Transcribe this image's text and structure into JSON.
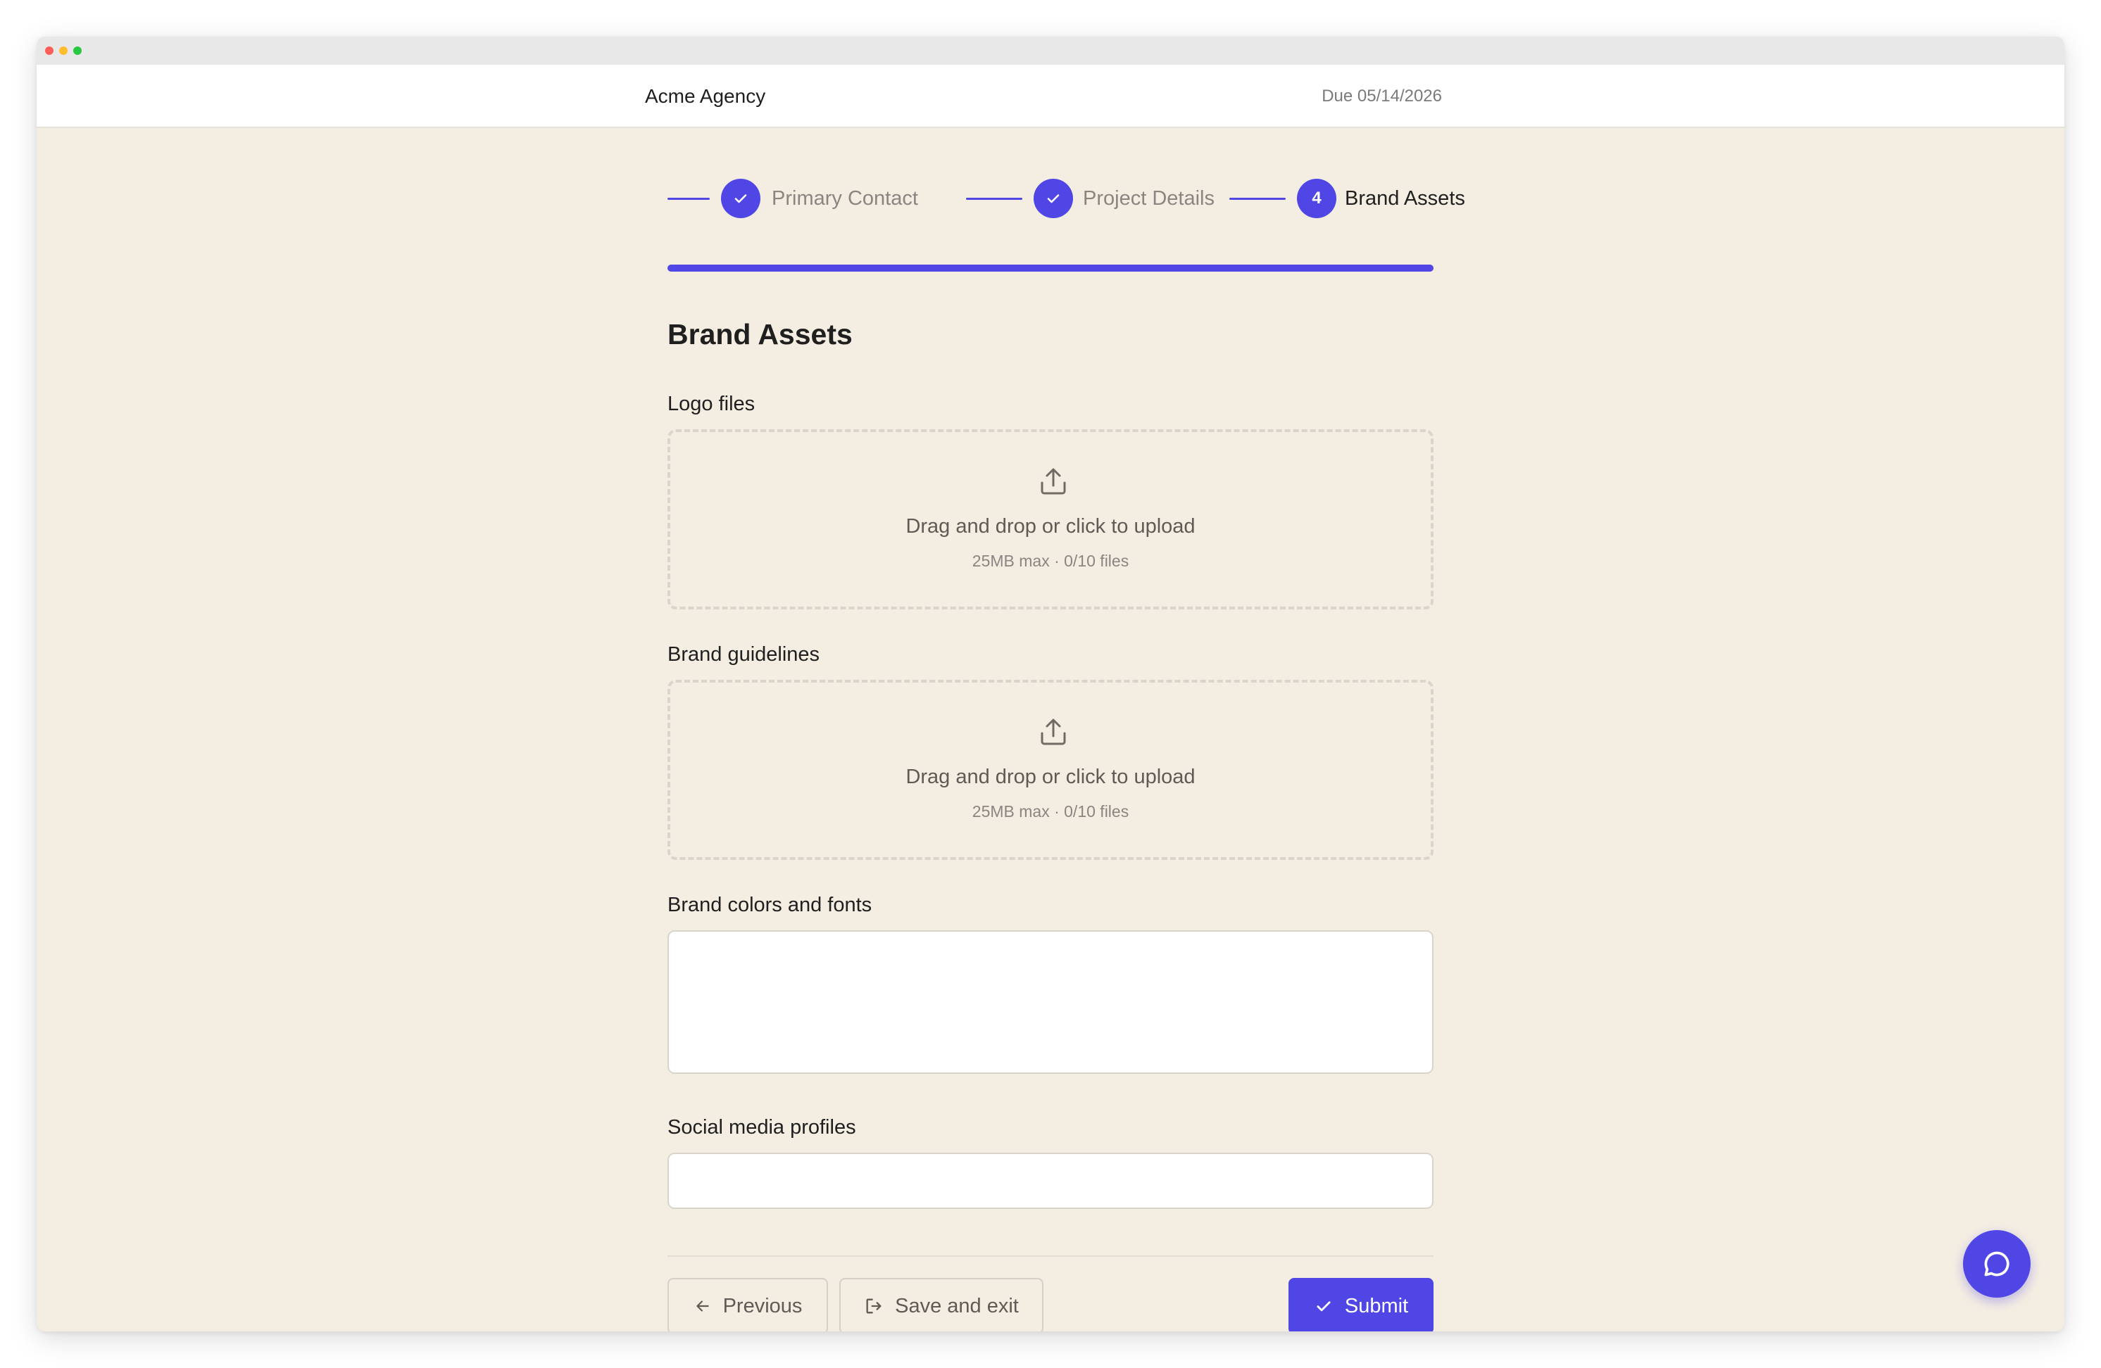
{
  "header": {
    "brand": "Acme Agency",
    "due": "Due 05/14/2026"
  },
  "stepper": {
    "steps": [
      {
        "label": "Primary Contact",
        "state": "done"
      },
      {
        "label": "Project Details",
        "state": "done"
      },
      {
        "label": "Brand Assets",
        "state": "current",
        "number": "4"
      }
    ],
    "progress_percent": 100
  },
  "form": {
    "title": "Brand Assets",
    "fields": [
      {
        "label": "Logo files",
        "type": "upload",
        "upload_text": "Drag and drop or click to upload",
        "upload_hint": "25MB max · 0/10 files"
      },
      {
        "label": "Brand guidelines",
        "type": "upload",
        "upload_text": "Drag and drop or click to upload",
        "upload_hint": "25MB max · 0/10 files"
      },
      {
        "label": "Brand colors and fonts",
        "type": "textarea",
        "value": ""
      },
      {
        "label": "Social media profiles",
        "type": "text",
        "value": ""
      }
    ]
  },
  "actions": {
    "previous": "Previous",
    "save_exit": "Save and exit",
    "submit": "Submit"
  },
  "icons": {
    "upload": "upload-icon",
    "check": "check-icon",
    "arrow_left": "arrow-left-icon",
    "exit": "exit-icon",
    "chat": "chat-bubble-icon"
  },
  "colors": {
    "accent": "#4f46e5",
    "background": "#f4eee2"
  }
}
